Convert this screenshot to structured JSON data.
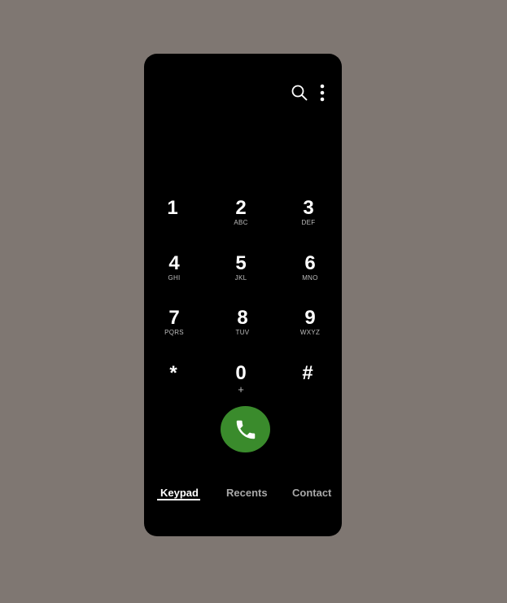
{
  "header": {
    "icons": [
      "search-icon",
      "more-vertical-icon"
    ]
  },
  "keypad": {
    "keys": [
      {
        "digit": "1",
        "letters": ""
      },
      {
        "digit": "2",
        "letters": "ABC"
      },
      {
        "digit": "3",
        "letters": "DEF"
      },
      {
        "digit": "4",
        "letters": "GHI"
      },
      {
        "digit": "5",
        "letters": "JKL"
      },
      {
        "digit": "6",
        "letters": "MNO"
      },
      {
        "digit": "7",
        "letters": "PQRS"
      },
      {
        "digit": "8",
        "letters": "TUV"
      },
      {
        "digit": "9",
        "letters": "WXYZ"
      },
      {
        "digit": "*",
        "letters": ""
      },
      {
        "digit": "0",
        "letters": "+"
      },
      {
        "digit": "#",
        "letters": ""
      }
    ]
  },
  "call_button": {
    "icon": "phone-icon",
    "color": "#3a8b2c"
  },
  "tabs": [
    {
      "label": "Keypad",
      "active": true
    },
    {
      "label": "Recents",
      "active": false
    },
    {
      "label": "Contact",
      "active": false
    }
  ],
  "colors": {
    "background": "#7f7772",
    "screen": "#000000",
    "text_active": "#ffffff",
    "text_inactive": "#a8a8a8"
  }
}
